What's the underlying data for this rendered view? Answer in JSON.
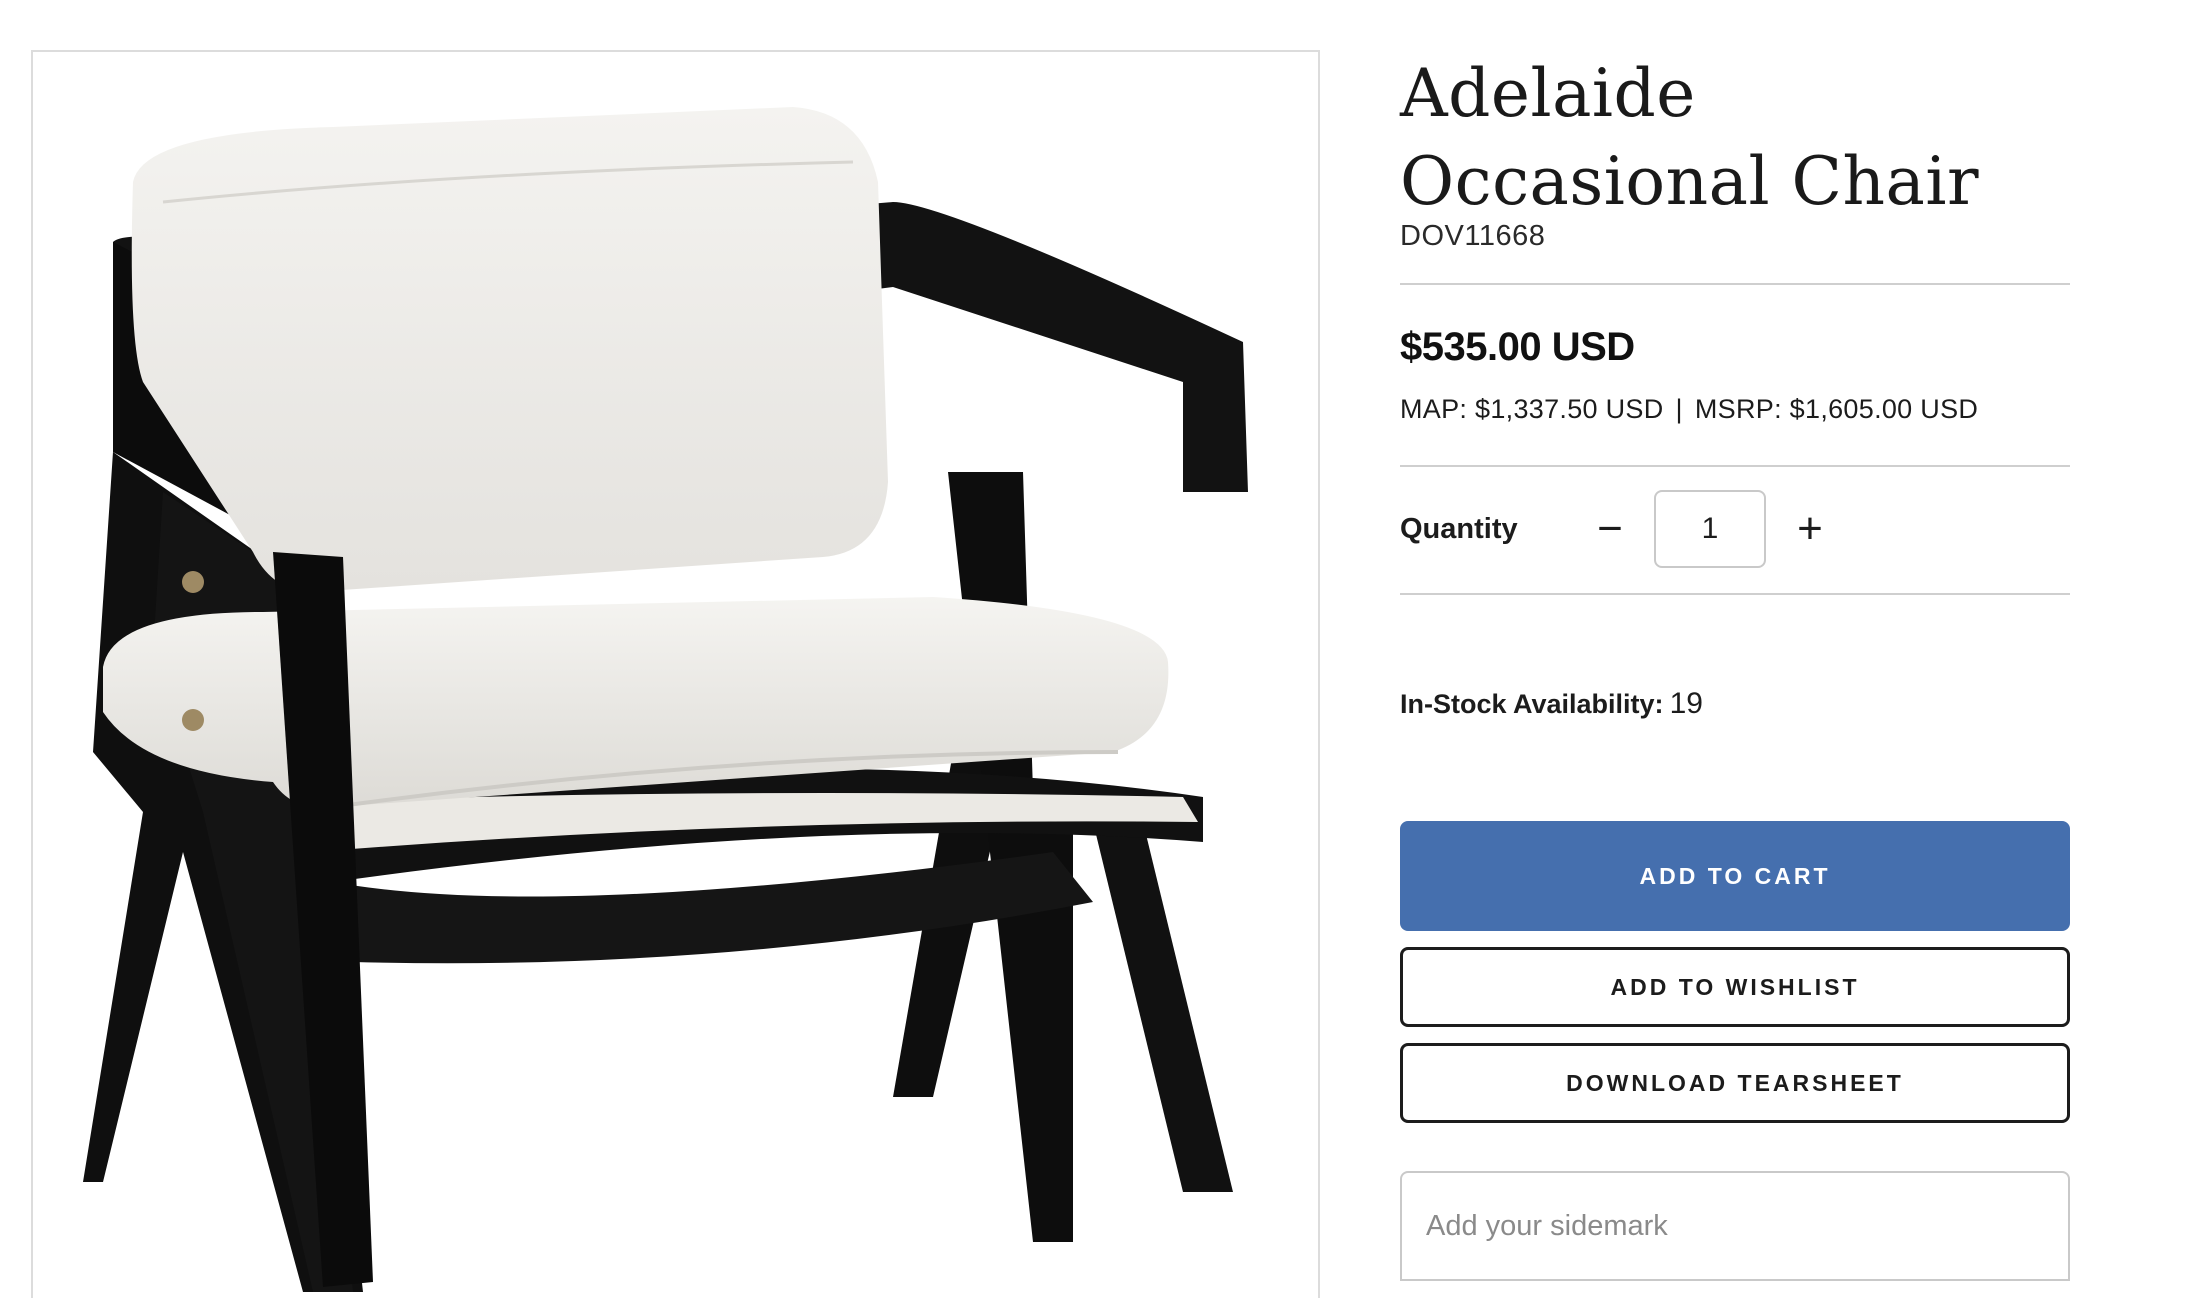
{
  "product": {
    "title": "Adelaide Occasional Chair",
    "sku": "DOV11668",
    "price": "$535.00 USD",
    "map_price": "MAP: $1,337.50 USD",
    "separator": "|",
    "msrp_price": "MSRP: $1,605.00 USD",
    "image_alt": "black wood-frame-chair-with-cream-cushions"
  },
  "quantity": {
    "label": "Quantity",
    "value": "1",
    "decrement_symbol": "−",
    "increment_symbol": "+"
  },
  "stock": {
    "label": "In-Stock Availability:",
    "count": "19"
  },
  "actions": {
    "add_to_cart": "ADD TO CART",
    "add_to_wishlist": "ADD TO WISHLIST",
    "download_tearsheet": "DOWNLOAD TEARSHEET"
  },
  "sidemark": {
    "placeholder": "Add your sidemark"
  },
  "colors": {
    "primary_button": "#456fae",
    "text": "#1c1c1c",
    "divider": "#cfcfcf"
  }
}
